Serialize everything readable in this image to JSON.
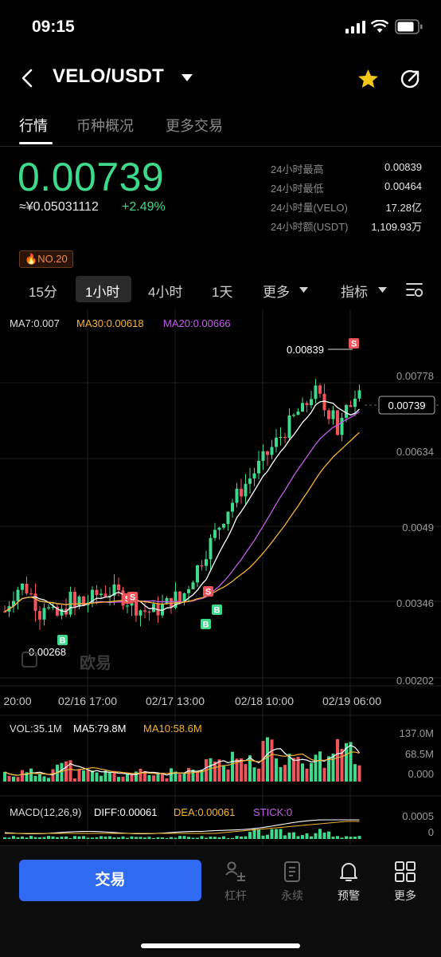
{
  "status_bar": {
    "time": "09:15"
  },
  "header": {
    "pair": "VELO/USDT"
  },
  "tabs": [
    "行情",
    "币种概况",
    "更多交易"
  ],
  "ticker": {
    "last_price": "0.00739",
    "cny_price": "≈¥0.05031112",
    "change_pct": "+2.49%",
    "stats": [
      {
        "label": "24小时最高",
        "value": "0.00839"
      },
      {
        "label": "24小时最低",
        "value": "0.00464"
      },
      {
        "label": "24小时量(VELO)",
        "value": "17.28亿"
      },
      {
        "label": "24小时额(USDT)",
        "value": "1,109.93万"
      }
    ],
    "rank_badge": "NO.20"
  },
  "timeframes": {
    "items": [
      "15分",
      "1小时",
      "4小时",
      "1天",
      "更多"
    ],
    "active": "1小时",
    "indicator_label": "指标"
  },
  "indicators": {
    "ma7": "MA7:0.007",
    "ma30": "MA30:0.00618",
    "ma20": "MA20:0.00666"
  },
  "volume_legend": {
    "vol": "VOL:35.1M",
    "ma5": "MA5:79.8M",
    "ma10": "MA10:58.6M"
  },
  "macd_legend": {
    "label": "MACD(12,26,9)",
    "diff": "DIFF:0.00061",
    "dea": "DEA:0.00061",
    "stick": "STICK:0"
  },
  "watermark": "欧易",
  "chart_data": [
    {
      "type": "candlestick",
      "y_ticks": [
        "0.00778",
        "0.00634",
        "0.0049",
        "0.00346",
        "0.00202"
      ],
      "x_ticks": [
        "20:00",
        "02/16 17:00",
        "02/17 13:00",
        "02/18 10:00",
        "02/19 06:00"
      ],
      "high_annotation": "0.00839",
      "low_annotation": "0.00268",
      "current_price_label": "0.00739",
      "ylim": [
        0.00202,
        0.00845
      ],
      "markers": [
        "B",
        "S"
      ],
      "colors": {
        "up": "#3fd98b",
        "down": "#f0535a",
        "ma7": "#ffffff",
        "ma30": "#f5b332",
        "ma20": "#c25ce8"
      }
    },
    {
      "type": "bar",
      "name": "volume",
      "y_ticks": [
        "137.0M",
        "68.5M",
        "0.000"
      ]
    },
    {
      "type": "bar",
      "name": "macd",
      "y_ticks": [
        "0.0005",
        "0"
      ]
    }
  ],
  "bottom_nav": {
    "trade": "交易",
    "items": [
      "杠杆",
      "永续",
      "预警",
      "更多"
    ]
  }
}
